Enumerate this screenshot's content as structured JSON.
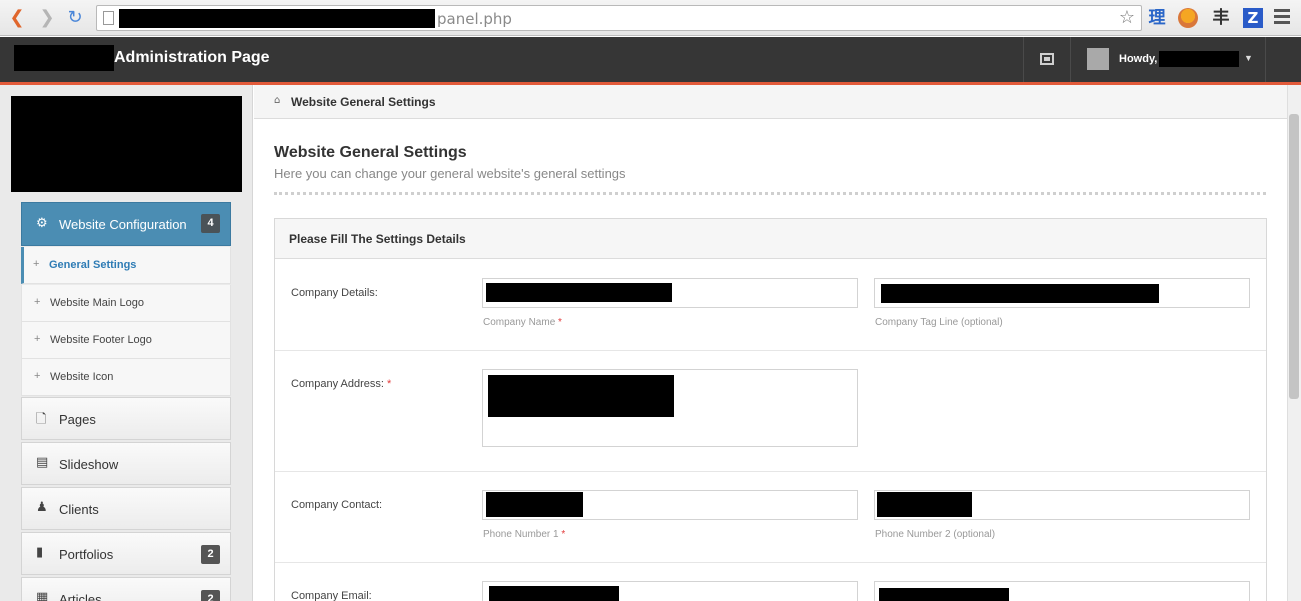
{
  "browser": {
    "url_visible": "panel.php",
    "icons": [
      "back-icon",
      "forward-icon",
      "reload-icon",
      "page-icon",
      "star-icon",
      "menu-icon"
    ],
    "extensions": {
      "li": "理",
      "bar": "丰",
      "z": "Z"
    }
  },
  "header": {
    "title": "Administration Page",
    "howdy": "Howdy,",
    "accent_color": "#e25a3a",
    "background_color": "#363636"
  },
  "sidebar": {
    "active_section": {
      "label": "Website Configuration",
      "badge": "4",
      "color": "#4b8db3"
    },
    "sub_items": [
      {
        "label": "General Settings",
        "active": true
      },
      {
        "label": "Website Main Logo",
        "active": false
      },
      {
        "label": "Website Footer Logo",
        "active": false
      },
      {
        "label": "Website Icon",
        "active": false
      }
    ],
    "items": [
      {
        "label": "Pages",
        "icon": "page-icon",
        "badge": ""
      },
      {
        "label": "Slideshow",
        "icon": "film-icon",
        "badge": ""
      },
      {
        "label": "Clients",
        "icon": "users-icon",
        "badge": ""
      },
      {
        "label": "Portfolios",
        "icon": "book-icon",
        "badge": "2"
      },
      {
        "label": "Articles",
        "icon": "article-icon",
        "badge": "2"
      }
    ]
  },
  "breadcrumb": {
    "text": "Website General Settings"
  },
  "main": {
    "title": "Website General Settings",
    "subtitle": "Here you can change your general website's general settings",
    "panel_title": "Please Fill The Settings Details",
    "fields": {
      "company_details": {
        "label": "Company Details:",
        "help1": "Company Name",
        "help2": "Company Tag Line (optional)"
      },
      "company_address": {
        "label": "Company Address:"
      },
      "company_contact": {
        "label": "Company Contact:",
        "help1": "Phone Number 1",
        "help2": "Phone Number 2 (optional)"
      },
      "company_email": {
        "label": "Company Email:"
      },
      "required_marker": "*"
    }
  }
}
